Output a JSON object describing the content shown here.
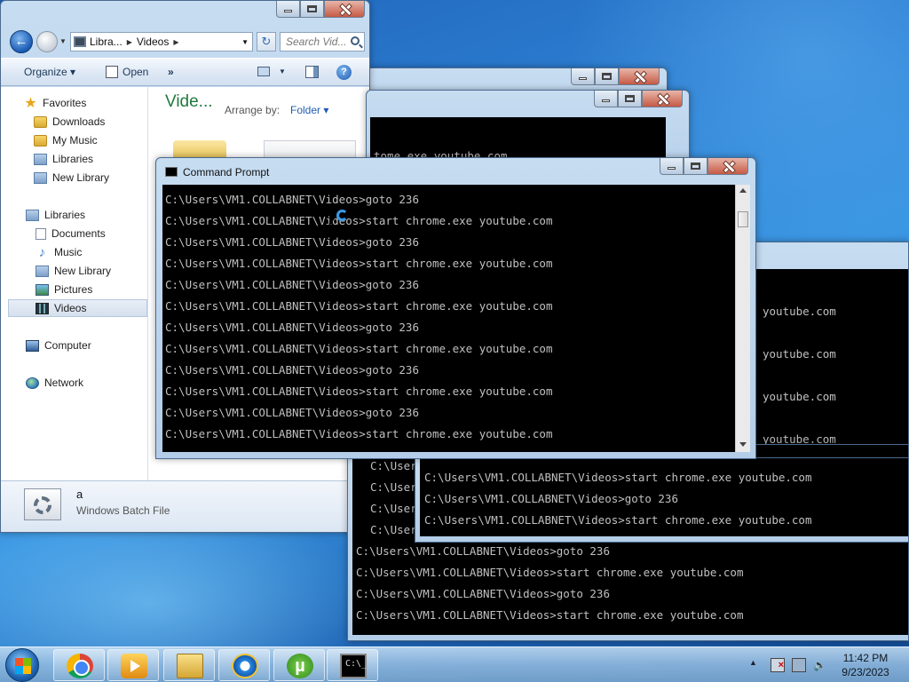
{
  "explorer": {
    "nav": {
      "breadcrumb": [
        "Libra...",
        "Videos"
      ],
      "search_placeholder": "Search Vid..."
    },
    "toolbar": {
      "organize": "Organize",
      "open": "Open",
      "more": "»"
    },
    "sidebar": {
      "favorites_header": "Favorites",
      "favorites": [
        "Downloads",
        "My Music",
        "Libraries",
        "New Library"
      ],
      "libraries_header": "Libraries",
      "libraries": [
        "Documents",
        "Music",
        "New Library",
        "Pictures",
        "Videos"
      ],
      "computer": "Computer",
      "network": "Network"
    },
    "content": {
      "title": "Vide...",
      "arrange_by_label": "Arrange by:",
      "arrange_value": "Folder"
    },
    "details": {
      "name": "a",
      "type": "Windows Batch File"
    }
  },
  "cmd_main": {
    "title": "Command Prompt",
    "lines": [
      "C:\\Users\\VM1.COLLABNET\\Videos>goto 236",
      "C:\\Users\\VM1.COLLABNET\\Videos>start chrome.exe youtube.com",
      "C:\\Users\\VM1.COLLABNET\\Videos>goto 236",
      "C:\\Users\\VM1.COLLABNET\\Videos>start chrome.exe youtube.com",
      "C:\\Users\\VM1.COLLABNET\\Videos>goto 236",
      "C:\\Users\\VM1.COLLABNET\\Videos>start chrome.exe youtube.com",
      "C:\\Users\\VM1.COLLABNET\\Videos>goto 236",
      "C:\\Users\\VM1.COLLABNET\\Videos>start chrome.exe youtube.com",
      "C:\\Users\\VM1.COLLABNET\\Videos>goto 236",
      "C:\\Users\\VM1.COLLABNET\\Videos>start chrome.exe youtube.com",
      "C:\\Users\\VM1.COLLABNET\\Videos>goto 236",
      "C:\\Users\\VM1.COLLABNET\\Videos>start chrome.exe youtube.com"
    ]
  },
  "cmd_back2": {
    "partial_line": "tome.exe youtube.com"
  },
  "cmd_right": {
    "partial_lines": [
      "youtube.com",
      "youtube.com",
      "youtube.com",
      "youtube.com"
    ]
  },
  "cmd_mid": {
    "left_fragments": [
      "C:\\Users",
      "C:\\Users",
      "C:\\Users",
      "C:\\Users"
    ],
    "lines": [
      "C:\\Users\\VM1.COLLABNET\\Videos>start chrome.exe youtube.com",
      "C:\\Users\\VM1.COLLABNET\\Videos>goto 236",
      "C:\\Users\\VM1.COLLABNET\\Videos>start chrome.exe youtube.com"
    ]
  },
  "cmd_bottom": {
    "lines": [
      "C:\\Users\\VM1.COLLABNET\\Videos>goto 236",
      "C:\\Users\\VM1.COLLABNET\\Videos>start chrome.exe youtube.com",
      "C:\\Users\\VM1.COLLABNET\\Videos>goto 236",
      "C:\\Users\\VM1.COLLABNET\\Videos>start chrome.exe youtube.com"
    ]
  },
  "taskbar": {
    "apps": [
      "chrome-icon",
      "media-center-icon",
      "explorer-icon",
      "internet-explorer-icon",
      "utorrent-icon",
      "command-prompt-icon"
    ],
    "utorrent_glyph": "µ",
    "cmd_glyph": "C:\\_",
    "time": "11:42 PM",
    "date": "9/23/2023"
  }
}
